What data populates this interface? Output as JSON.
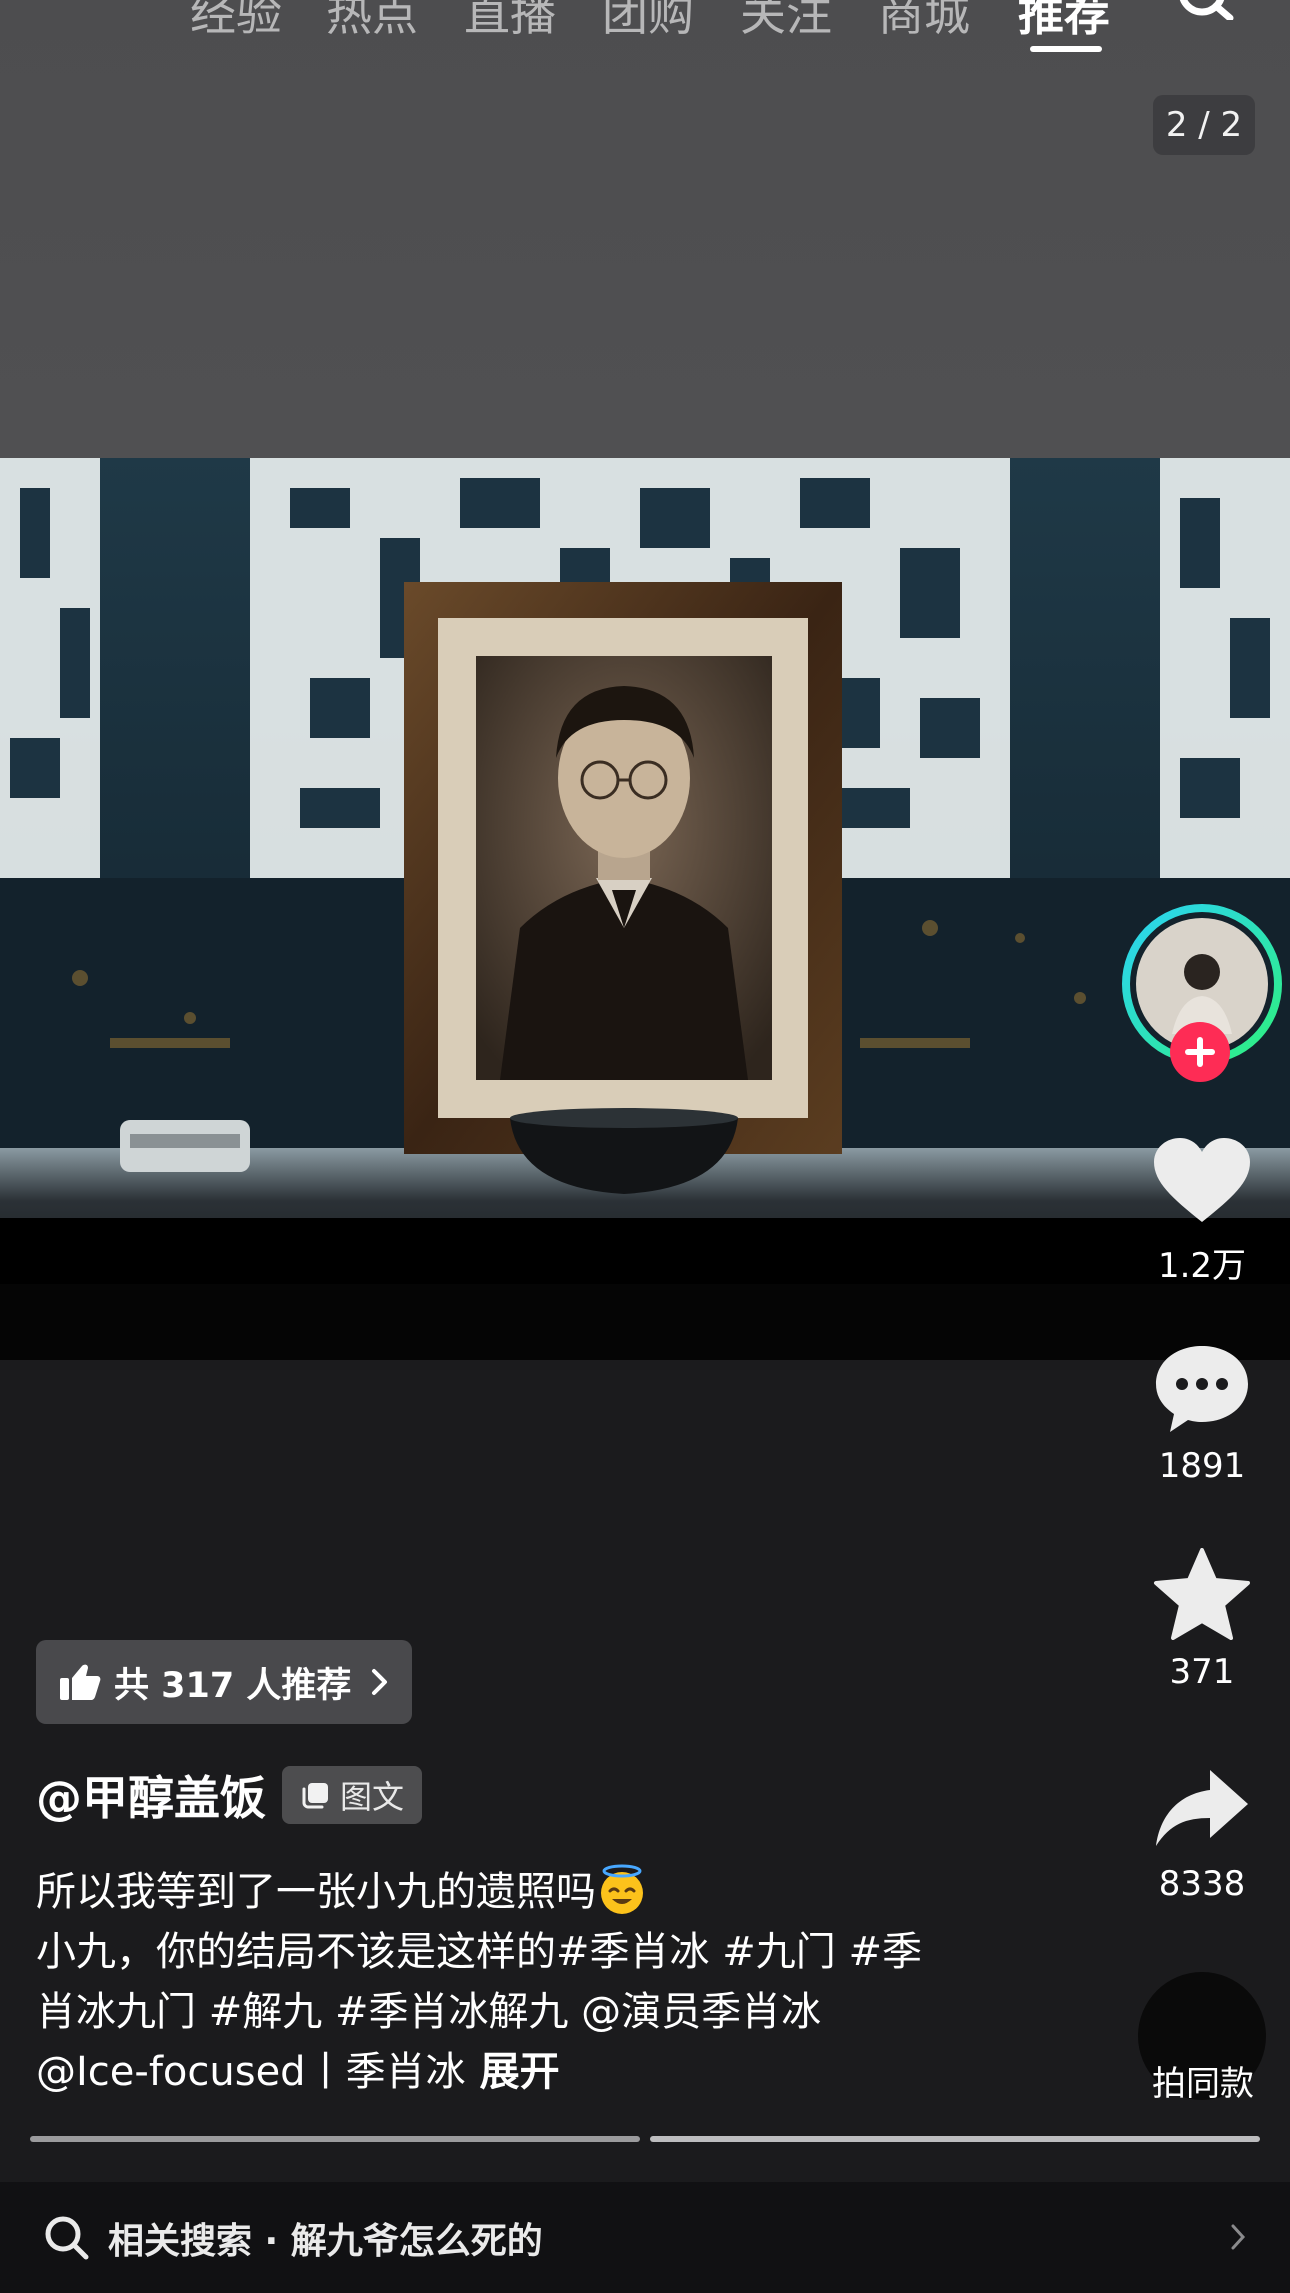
{
  "top_nav": {
    "tabs": [
      "经验",
      "热点",
      "直播",
      "团购",
      "关注",
      "商城",
      "推荐"
    ],
    "active_tab": "推荐",
    "menu_icon": "hamburger-icon",
    "search_icon": "search-icon"
  },
  "post": {
    "page_indicator": "2 / 2",
    "recommend_text": "共 317 人推荐",
    "author": "@甲醇盖饭",
    "type_badge": "图文",
    "caption_line1": "所以我等到了一张小九的遗照吗",
    "caption_line2": "小九，你的结局不该是这样的#季肖冰 #九门 #季",
    "caption_line3": "肖冰九门 #解九 #季肖冰解九 @演员季肖冰",
    "caption_line4": "@Ice-focused丨季肖冰",
    "expand_label": "展开",
    "emoji": "smiling-face-with-halo"
  },
  "actions": {
    "likes": "1.2万",
    "comments": "1891",
    "favorites": "371",
    "shares": "8338",
    "same_style": "拍同款"
  },
  "related_search": {
    "text": "相关搜索 · 解九爷怎么死的"
  },
  "progress": {
    "segments": 2,
    "current": 2
  },
  "colors": {
    "follow_plus": "#fe2c55",
    "avatar_ring_start": "#2bd3f5",
    "avatar_ring_end": "#2ff07f",
    "background": "#1b1b1d"
  }
}
